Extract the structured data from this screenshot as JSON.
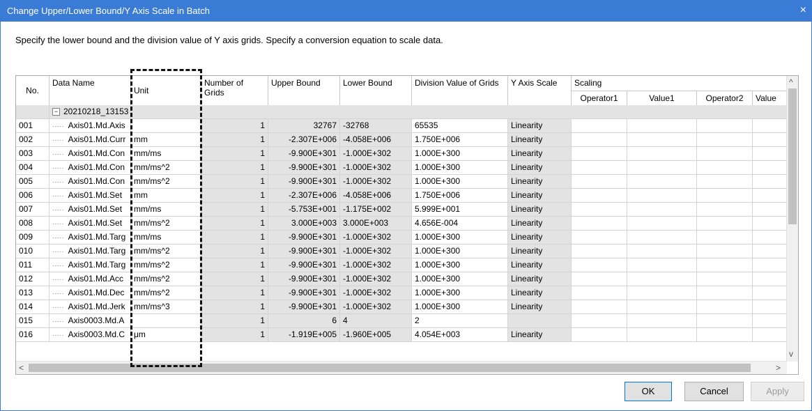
{
  "window": {
    "title": "Change Upper/Lower Bound/Y Axis Scale in Batch"
  },
  "instruction": "Specify the lower bound and the division value of Y axis grids. Specify a conversion equation to scale data.",
  "columns": {
    "no": "No.",
    "data_name": "Data Name",
    "unit": "Unit",
    "number_of_grids": "Number of Grids",
    "upper_bound": "Upper Bound",
    "lower_bound": "Lower Bound",
    "division_value": "Division Value of Grids",
    "y_axis_scale": "Y Axis Scale",
    "scaling": "Scaling",
    "operator1": "Operator1",
    "value1": "Value1",
    "operator2": "Operator2",
    "value2": "Value"
  },
  "group_row": {
    "label": "20210218_13153",
    "expander": "−"
  },
  "rows": [
    {
      "no": "001",
      "name": "Axis01.Md.Axis",
      "unit": "",
      "grids": "1",
      "upper": "32767",
      "lower": "-32768",
      "division": "65535",
      "scale": "Linearity"
    },
    {
      "no": "002",
      "name": "Axis01.Md.Curr",
      "unit": "mm",
      "grids": "1",
      "upper": "-2.307E+006",
      "lower": "-4.058E+006",
      "division": "1.750E+006",
      "scale": "Linearity"
    },
    {
      "no": "003",
      "name": "Axis01.Md.Con",
      "unit": "mm/ms",
      "grids": "1",
      "upper": "-9.900E+301",
      "lower": "-1.000E+302",
      "division": "1.000E+300",
      "scale": "Linearity"
    },
    {
      "no": "004",
      "name": "Axis01.Md.Con",
      "unit": "mm/ms^2",
      "grids": "1",
      "upper": "-9.900E+301",
      "lower": "-1.000E+302",
      "division": "1.000E+300",
      "scale": "Linearity"
    },
    {
      "no": "005",
      "name": "Axis01.Md.Con",
      "unit": "mm/ms^2",
      "grids": "1",
      "upper": "-9.900E+301",
      "lower": "-1.000E+302",
      "division": "1.000E+300",
      "scale": "Linearity"
    },
    {
      "no": "006",
      "name": "Axis01.Md.Set",
      "unit": "mm",
      "grids": "1",
      "upper": "-2.307E+006",
      "lower": "-4.058E+006",
      "division": "1.750E+006",
      "scale": "Linearity"
    },
    {
      "no": "007",
      "name": "Axis01.Md.Set",
      "unit": "mm/ms",
      "grids": "1",
      "upper": "-5.753E+001",
      "lower": "-1.175E+002",
      "division": "5.999E+001",
      "scale": "Linearity"
    },
    {
      "no": "008",
      "name": "Axis01.Md.Set",
      "unit": "mm/ms^2",
      "grids": "1",
      "upper": "3.000E+003",
      "lower": "3.000E+003",
      "division": "4.656E-004",
      "scale": "Linearity"
    },
    {
      "no": "009",
      "name": "Axis01.Md.Targ",
      "unit": "mm/ms",
      "grids": "1",
      "upper": "-9.900E+301",
      "lower": "-1.000E+302",
      "division": "1.000E+300",
      "scale": "Linearity"
    },
    {
      "no": "010",
      "name": "Axis01.Md.Targ",
      "unit": "mm/ms^2",
      "grids": "1",
      "upper": "-9.900E+301",
      "lower": "-1.000E+302",
      "division": "1.000E+300",
      "scale": "Linearity"
    },
    {
      "no": "011",
      "name": "Axis01.Md.Targ",
      "unit": "mm/ms^2",
      "grids": "1",
      "upper": "-9.900E+301",
      "lower": "-1.000E+302",
      "division": "1.000E+300",
      "scale": "Linearity"
    },
    {
      "no": "012",
      "name": "Axis01.Md.Acc",
      "unit": "mm/ms^2",
      "grids": "1",
      "upper": "-9.900E+301",
      "lower": "-1.000E+302",
      "division": "1.000E+300",
      "scale": "Linearity"
    },
    {
      "no": "013",
      "name": "Axis01.Md.Dec",
      "unit": "mm/ms^2",
      "grids": "1",
      "upper": "-9.900E+301",
      "lower": "-1.000E+302",
      "division": "1.000E+300",
      "scale": "Linearity"
    },
    {
      "no": "014",
      "name": "Axis01.Md.Jerk",
      "unit": "mm/ms^3",
      "grids": "1",
      "upper": "-9.900E+301",
      "lower": "-1.000E+302",
      "division": "1.000E+300",
      "scale": "Linearity"
    },
    {
      "no": "015",
      "name": "Axis0003.Md.A",
      "unit": "",
      "grids": "1",
      "upper": "6",
      "lower": "4",
      "division": "2",
      "scale": ""
    },
    {
      "no": "016",
      "name": "Axis0003.Md.C",
      "unit": "μm",
      "grids": "1",
      "upper": "-1.919E+005",
      "lower": "-1.960E+005",
      "division": "4.054E+003",
      "scale": "Linearity"
    }
  ],
  "buttons": {
    "ok": "OK",
    "cancel": "Cancel",
    "apply": "Apply"
  },
  "icons": {
    "close": "×",
    "tree_line": "·····",
    "scroll_up": "^",
    "scroll_down": "v",
    "scroll_left": "<",
    "scroll_right": ">"
  }
}
